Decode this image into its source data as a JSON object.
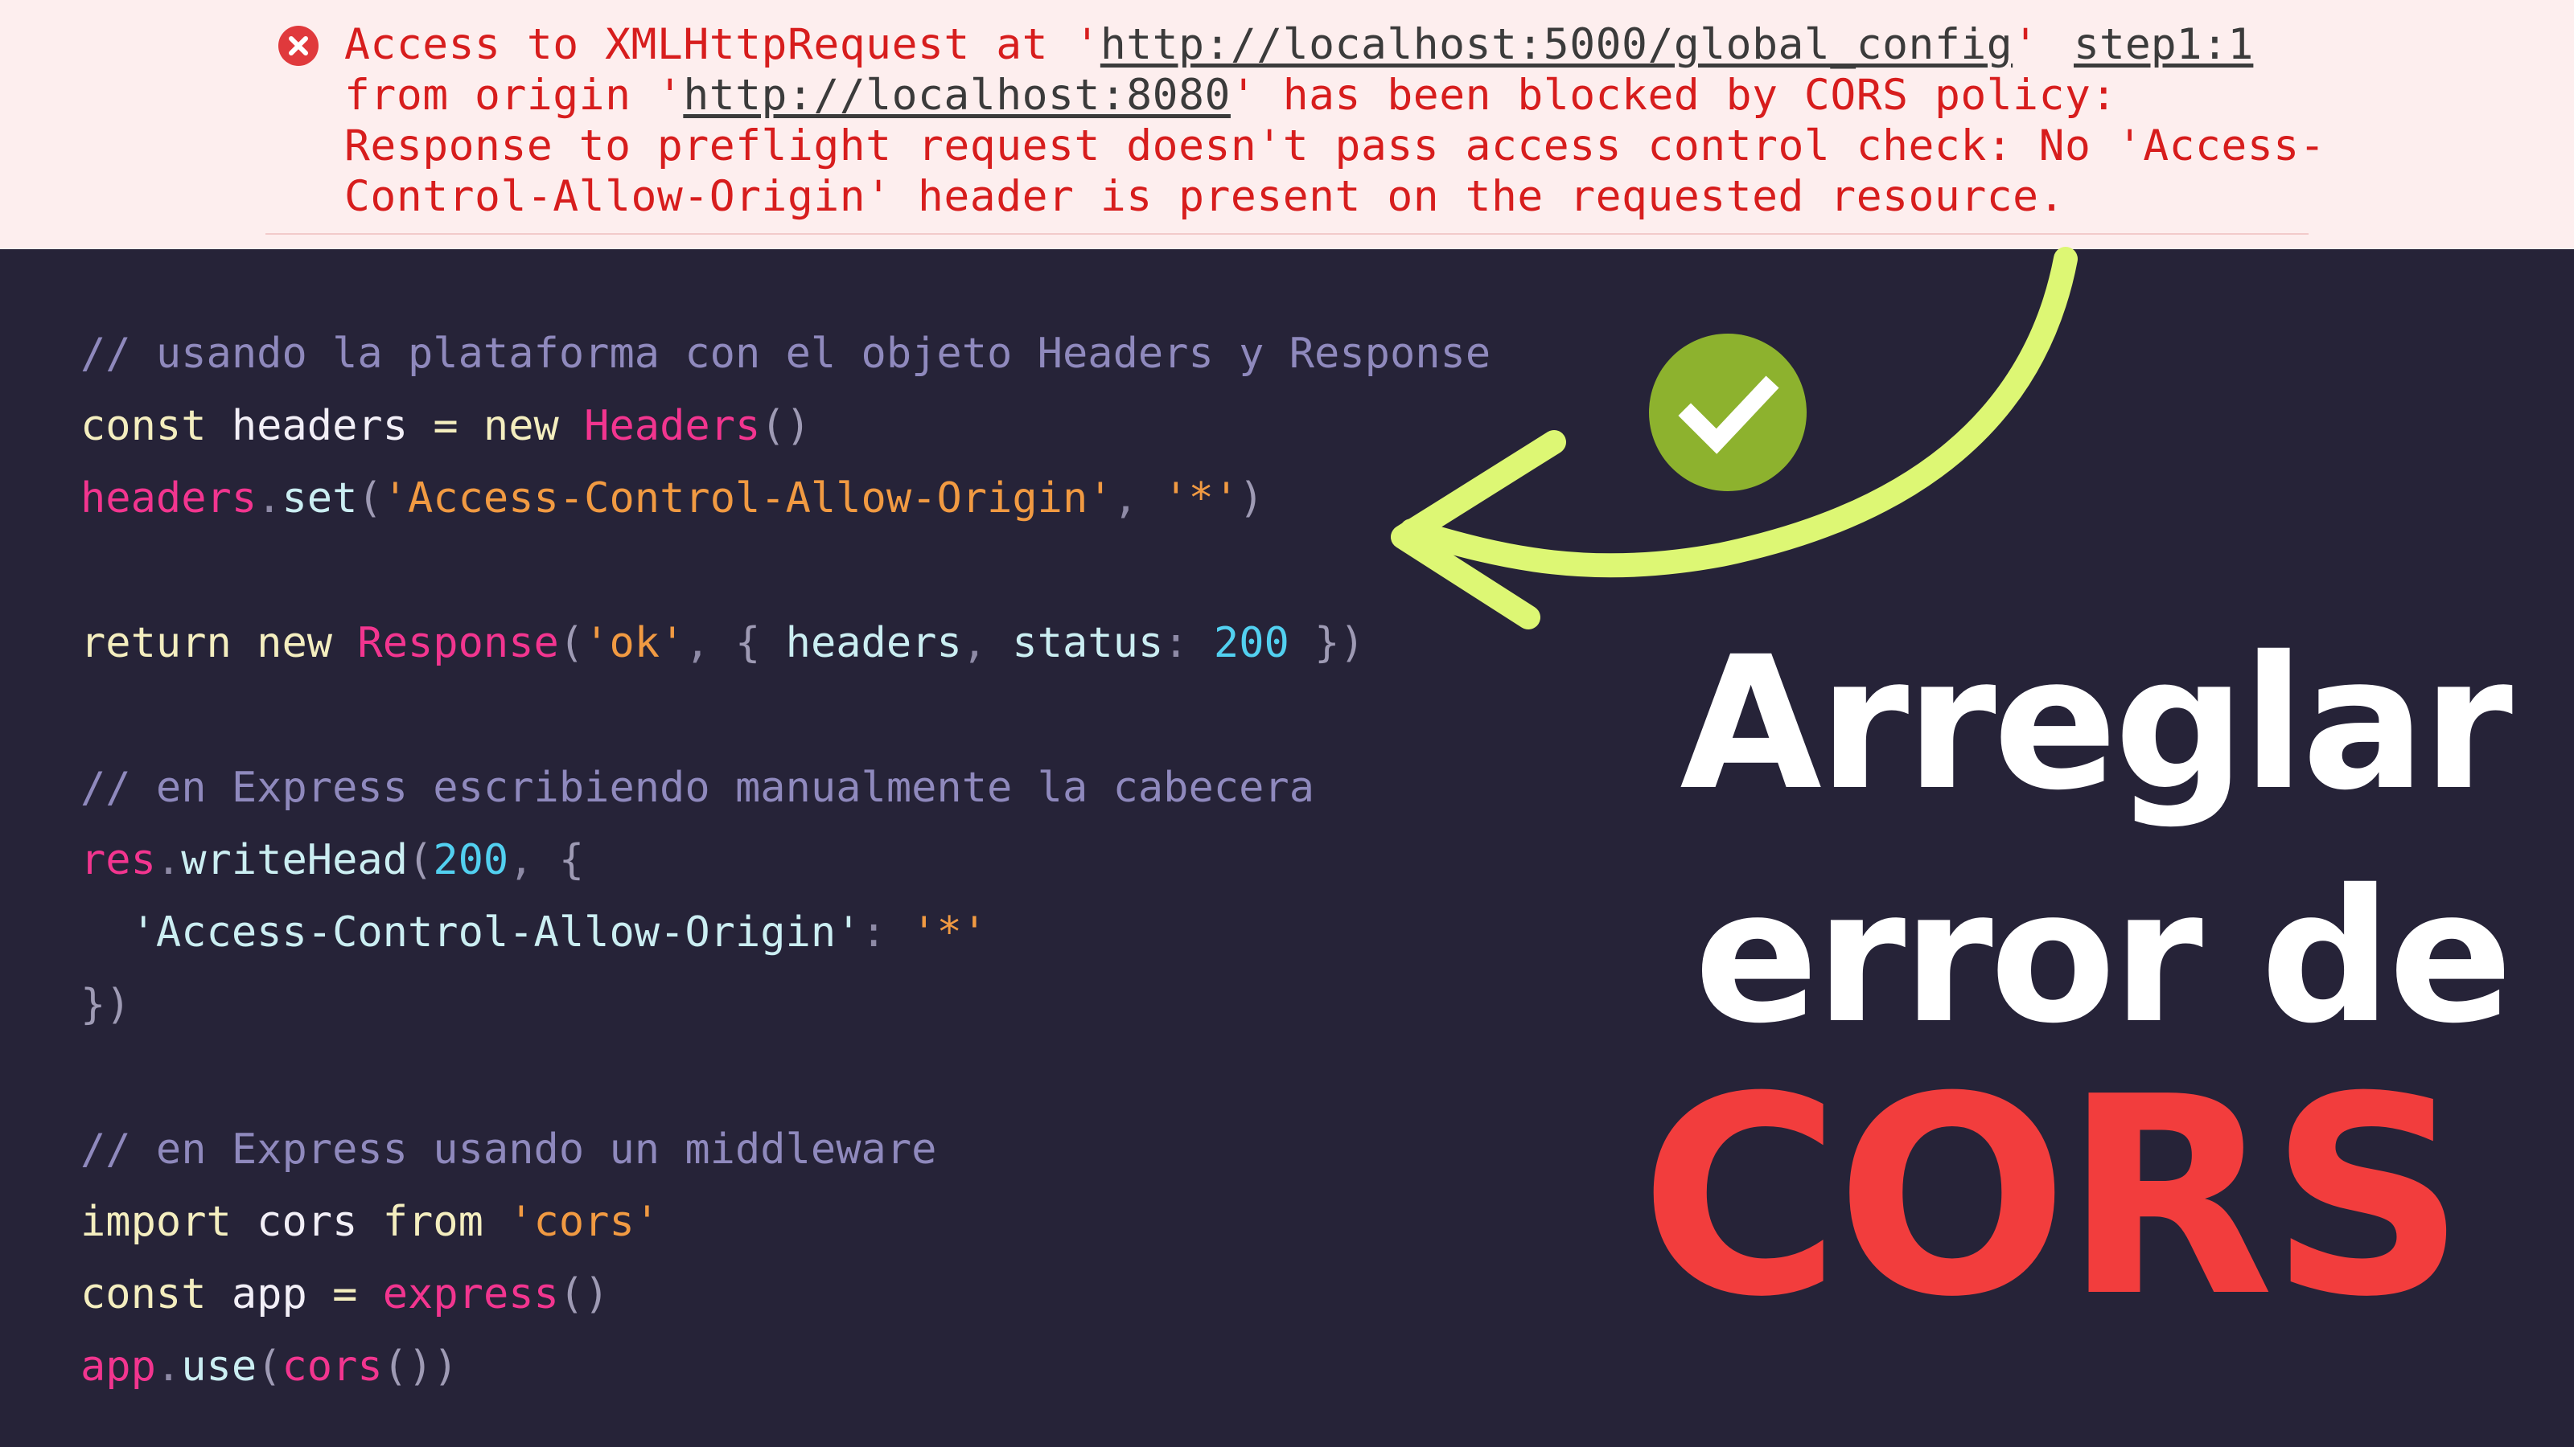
{
  "console": {
    "error_line1_prefix": "Access to XMLHttpRequest at '",
    "error_url1": "http://localhost:5000/global_config",
    "error_line1_suffix": "'",
    "source_link": "step1:1",
    "error_line2_prefix": "from origin '",
    "error_url2": "http://localhost:8080",
    "error_line2_suffix": "' has been blocked by CORS policy:",
    "error_line3": "Response to preflight request doesn't pass access control check: No 'Access-",
    "error_line4": "Control-Allow-Origin' header is present on the requested resource.",
    "colors": {
      "background": "#fdeeee",
      "error_text": "#d71d1d",
      "link": "#3b3b3b"
    }
  },
  "code": {
    "lines": [
      [
        {
          "t": "// usando la plataforma con el objeto Headers y Response",
          "k": "comment"
        }
      ],
      [
        {
          "t": "const",
          "k": "keyword"
        },
        {
          "t": " headers ",
          "k": "ident"
        },
        {
          "t": "=",
          "k": "op"
        },
        {
          "t": " new ",
          "k": "keyword"
        },
        {
          "t": "Headers",
          "k": "class"
        },
        {
          "t": "()",
          "k": "brace"
        }
      ],
      [
        {
          "t": "headers",
          "k": "class"
        },
        {
          "t": ".",
          "k": "punct"
        },
        {
          "t": "set",
          "k": "prop"
        },
        {
          "t": "(",
          "k": "brace"
        },
        {
          "t": "'Access-Control-Allow-Origin'",
          "k": "string"
        },
        {
          "t": ", ",
          "k": "punct"
        },
        {
          "t": "'*'",
          "k": "string"
        },
        {
          "t": ")",
          "k": "brace"
        }
      ],
      [],
      [
        {
          "t": "return",
          "k": "keyword"
        },
        {
          "t": " new ",
          "k": "keyword"
        },
        {
          "t": "Response",
          "k": "class"
        },
        {
          "t": "(",
          "k": "brace"
        },
        {
          "t": "'ok'",
          "k": "string"
        },
        {
          "t": ", ",
          "k": "punct"
        },
        {
          "t": "{ ",
          "k": "brace"
        },
        {
          "t": "headers",
          "k": "prop"
        },
        {
          "t": ", ",
          "k": "punct"
        },
        {
          "t": "status",
          "k": "prop"
        },
        {
          "t": ": ",
          "k": "punct"
        },
        {
          "t": "200",
          "k": "num"
        },
        {
          "t": " })",
          "k": "brace"
        }
      ],
      [],
      [
        {
          "t": "// en Express escribiendo manualmente la cabecera",
          "k": "comment"
        }
      ],
      [
        {
          "t": "res",
          "k": "class"
        },
        {
          "t": ".",
          "k": "punct"
        },
        {
          "t": "writeHead",
          "k": "prop"
        },
        {
          "t": "(",
          "k": "brace"
        },
        {
          "t": "200",
          "k": "num"
        },
        {
          "t": ", ",
          "k": "punct"
        },
        {
          "t": "{",
          "k": "brace"
        }
      ],
      [
        {
          "t": "  'Access-Control-Allow-Origin'",
          "k": "prop"
        },
        {
          "t": ": ",
          "k": "punct"
        },
        {
          "t": "'*'",
          "k": "string"
        }
      ],
      [
        {
          "t": "})",
          "k": "brace"
        }
      ],
      [],
      [
        {
          "t": "// en Express usando un middleware",
          "k": "comment"
        }
      ],
      [
        {
          "t": "import",
          "k": "keyword"
        },
        {
          "t": " cors ",
          "k": "ident"
        },
        {
          "t": "from",
          "k": "keyword"
        },
        {
          "t": " ",
          "k": "ident"
        },
        {
          "t": "'cors'",
          "k": "string"
        }
      ],
      [
        {
          "t": "const",
          "k": "keyword"
        },
        {
          "t": " app ",
          "k": "ident"
        },
        {
          "t": "=",
          "k": "op"
        },
        {
          "t": " ",
          "k": "ident"
        },
        {
          "t": "express",
          "k": "class"
        },
        {
          "t": "()",
          "k": "brace"
        }
      ],
      [
        {
          "t": "app",
          "k": "class"
        },
        {
          "t": ".",
          "k": "punct"
        },
        {
          "t": "use",
          "k": "prop"
        },
        {
          "t": "(",
          "k": "brace"
        },
        {
          "t": "cors",
          "k": "class"
        },
        {
          "t": "())",
          "k": "brace"
        }
      ]
    ],
    "colors": {
      "background": "#262338"
    }
  },
  "title": {
    "line1": "Arreglar",
    "line2": "error de",
    "line3": "CORS",
    "colors": {
      "white": "#ffffff",
      "red": "#f23d3d"
    }
  },
  "decorations": {
    "arrow_color": "#ddf774",
    "check_badge_color": "#8db22e",
    "icons": [
      "error-circle-icon",
      "checkmark-icon",
      "curved-arrow-icon"
    ]
  }
}
